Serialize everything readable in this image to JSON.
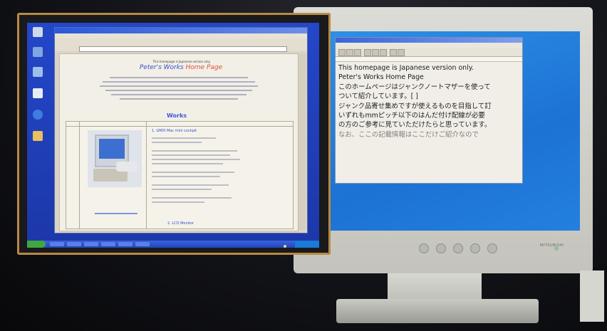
{
  "left_monitor": {
    "desktop_icons": [
      "",
      "",
      "",
      "",
      "",
      ""
    ],
    "browser": {
      "japanese_note": "This homepage is Japanese version only.",
      "site_title_a": "Peter's Works",
      "site_title_b": "Home Page",
      "works_heading": "Works",
      "item1_title": "1. GMIX Mac mini cockpit",
      "item2_title": "2. LCD Monitor"
    }
  },
  "right_monitor": {
    "brand": "MITSUBISHI",
    "notepad_lines": [
      "This homepage is Japanese version only.",
      "Peter's Works  Home Page",
      "このホームページはジャンクノートマザーを使って",
      "ついて紹介しています。[ ]",
      "ジャンク品寄せ集めですが使えるものを目指して訂",
      "いずれもmmピッチ以下のはんだ付け配線が必要",
      "の方のご参考に見ていただけたらと思っています。",
      "なお、ここの記載情報はここだけご紹介なので"
    ]
  },
  "colors": {
    "left_desktop": "#1f3fb8",
    "right_desktop": "#1d72d4",
    "title_blue": "#3050d0",
    "title_red": "#e0503a"
  }
}
